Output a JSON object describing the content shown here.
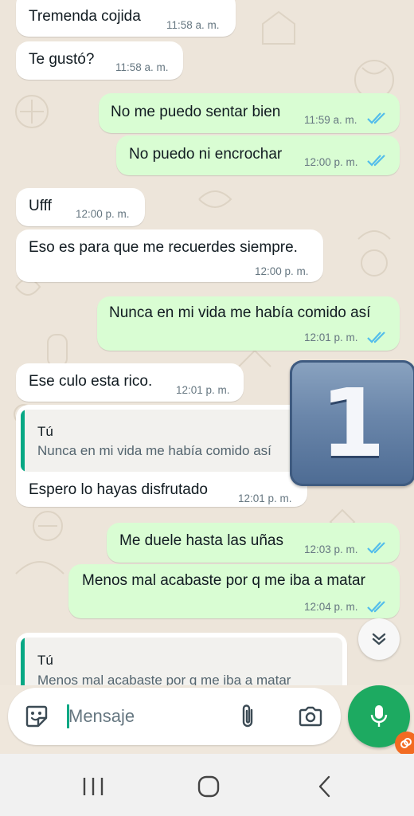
{
  "messages": [
    {
      "dir": "in",
      "text": "Tremenda cojida",
      "time": "11:58 a. m."
    },
    {
      "dir": "in",
      "text": "Te gustó?",
      "time": "11:58 a. m."
    },
    {
      "dir": "out",
      "text": "No me puedo sentar bien",
      "time": "11:59 a. m.",
      "status": "read"
    },
    {
      "dir": "out",
      "text": "No puedo ni encrochar",
      "time": "12:00 p. m.",
      "status": "read"
    },
    {
      "dir": "in",
      "text": "Ufff",
      "time": "12:00 p. m."
    },
    {
      "dir": "in",
      "text": "Eso es para que me recuerdes siempre.",
      "time": "12:00 p. m."
    },
    {
      "dir": "out",
      "text": "Nunca en mi vida me había comido así",
      "time": "12:01 p. m.",
      "status": "read"
    },
    {
      "dir": "in",
      "text": "Ese culo esta rico.",
      "time": "12:01 p. m."
    },
    {
      "dir": "in",
      "quote": {
        "author": "Tú",
        "text": "Nunca en mi vida me había comido así"
      },
      "text": "Espero lo hayas disfrutado",
      "time": "12:01 p. m."
    },
    {
      "dir": "out",
      "text": "Me duele hasta las uñas",
      "time": "12:03 p. m.",
      "status": "read"
    },
    {
      "dir": "out",
      "text": "Menos mal acabaste por q me iba a matar",
      "time": "12:04 p. m.",
      "status": "read"
    },
    {
      "dir": "in",
      "quote": {
        "author": "Tú",
        "text": "Menos mal acabaste por q me iba a matar"
      },
      "text": "",
      "time": ""
    }
  ],
  "overlay_badge": "1",
  "composer": {
    "placeholder": "Mensaje",
    "value": "",
    "icons": [
      "sticker-icon",
      "paperclip-icon",
      "camera-icon",
      "mic-icon"
    ]
  },
  "colors": {
    "incoming_bubble": "#ffffff",
    "outgoing_bubble": "#d9fdd3",
    "read_ticks": "#53bdeb",
    "accent_green": "#1daa61",
    "quote_bar": "#06a884"
  },
  "navbar": {
    "icons": [
      "recent-apps-icon",
      "home-icon",
      "back-icon"
    ]
  }
}
